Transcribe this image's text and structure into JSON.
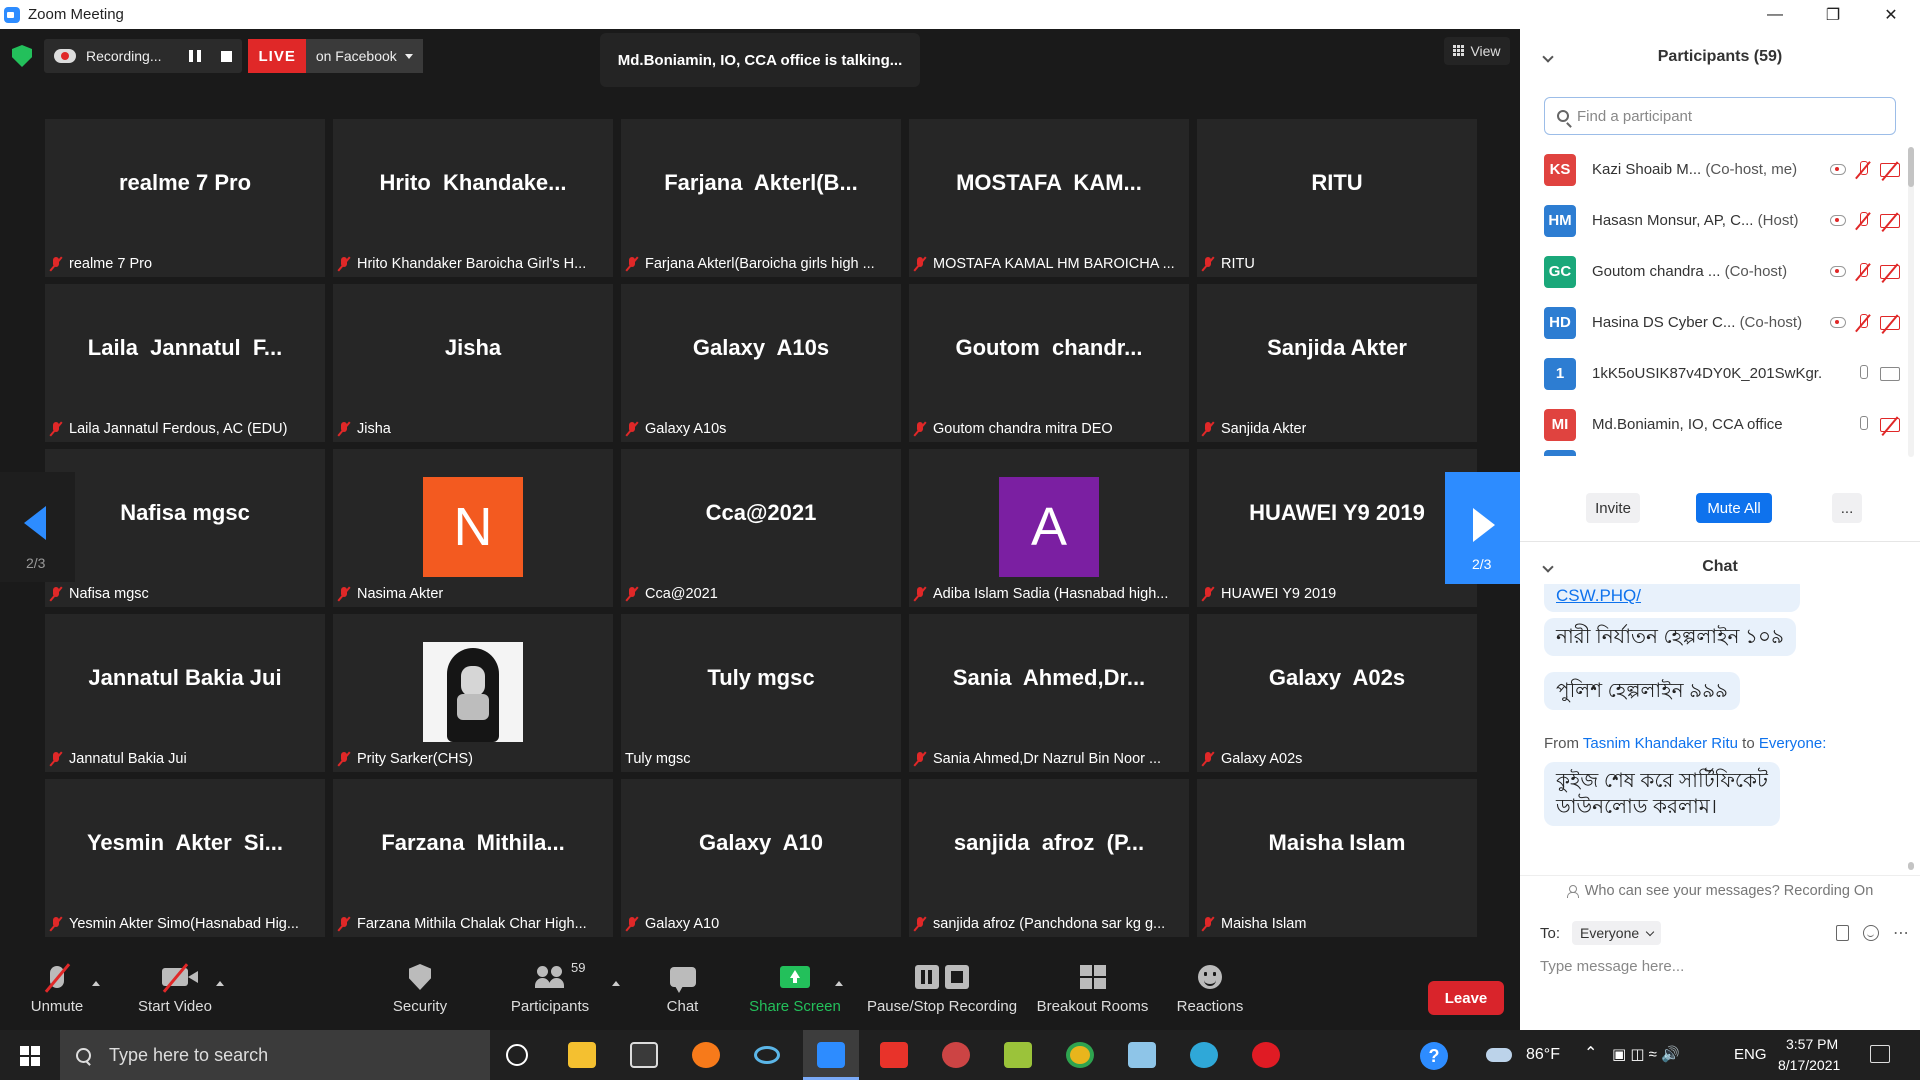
{
  "window": {
    "title": "Zoom Meeting"
  },
  "recording": {
    "status": "Recording...",
    "live_badge": "LIVE",
    "live_target": "on Facebook"
  },
  "talking": "Md.Boniamin, IO, CCA office is talking...",
  "view_label": "View",
  "tiles": [
    {
      "big": "realme 7 Pro",
      "label": "realme 7 Pro",
      "muted": true
    },
    {
      "big": "Hrito  Khandake...",
      "label": "Hrito Khandaker  Baroicha Girl's H...",
      "muted": true
    },
    {
      "big": "Farjana  Akterl(B...",
      "label": "Farjana Akterl(Baroicha girls high ...",
      "muted": true
    },
    {
      "big": "MOSTAFA  KAM...",
      "label": "MOSTAFA KAMAL HM BAROICHA ...",
      "muted": true
    },
    {
      "big": "RITU",
      "label": "RITU",
      "muted": true
    },
    {
      "big": "Laila  Jannatul  F...",
      "label": "Laila Jannatul Ferdous, AC (EDU)",
      "muted": true
    },
    {
      "big": "Jisha",
      "label": "Jisha",
      "muted": true
    },
    {
      "big": "Galaxy  A10s",
      "label": "Galaxy A10s",
      "muted": true
    },
    {
      "big": "Goutom  chandr...",
      "label": "Goutom chandra mitra DEO",
      "muted": true
    },
    {
      "big": "Sanjida Akter",
      "label": "Sanjida Akter",
      "muted": true
    },
    {
      "big": "Nafisa mgsc",
      "label": "Nafisa mgsc",
      "muted": true
    },
    {
      "big": "",
      "avatar": "N",
      "label": "Nasima Akter",
      "muted": true
    },
    {
      "big": "Cca@2021",
      "label": "Cca@2021",
      "muted": true
    },
    {
      "big": "",
      "avatar": "A",
      "label": "Adiba Islam Sadia (Hasnabad high...",
      "muted": true
    },
    {
      "big": "HUAWEI Y9 2019",
      "label": "HUAWEI Y9 2019",
      "muted": true
    },
    {
      "big": "Jannatul Bakia Jui",
      "label": "Jannatul Bakia Jui",
      "muted": true
    },
    {
      "big": "",
      "photo": true,
      "label": "Prity Sarker(CHS)",
      "muted": true
    },
    {
      "big": "Tuly mgsc",
      "label": "Tuly mgsc",
      "muted": false
    },
    {
      "big": "Sania  Ahmed,Dr...",
      "label": "Sania Ahmed,Dr Nazrul Bin Noor ...",
      "muted": true
    },
    {
      "big": "Galaxy  A02s",
      "label": "Galaxy A02s",
      "muted": true
    },
    {
      "big": "Yesmin  Akter  Si...",
      "label": "Yesmin Akter Simo(Hasnabad Hig...",
      "muted": true
    },
    {
      "big": "Farzana  Mithila...",
      "label": "Farzana Mithila   Chalak Char High...",
      "muted": true
    },
    {
      "big": "Galaxy  A10",
      "label": "Galaxy A10",
      "muted": true
    },
    {
      "big": "sanjida  afroz  (P...",
      "label": "sanjida afroz (Panchdona sar kg g...",
      "muted": true
    },
    {
      "big": "Maisha Islam",
      "label": "Maisha Islam",
      "muted": true
    }
  ],
  "pager": {
    "left": "2/3",
    "right": "2/3"
  },
  "toolbar": {
    "unmute": "Unmute",
    "start_video": "Start Video",
    "security": "Security",
    "participants": "Participants",
    "participants_count": "59",
    "chat": "Chat",
    "share_screen": "Share Screen",
    "pause_stop": "Pause/Stop Recording",
    "breakout": "Breakout Rooms",
    "reactions": "Reactions",
    "leave": "Leave"
  },
  "participants_panel": {
    "title": "Participants (59)",
    "search_placeholder": "Find a participant",
    "rows": [
      {
        "initials": "KS",
        "color": "#e0433f",
        "name": "Kazi Shoaib M...",
        "role": "(Co-host, me)",
        "rec": true,
        "mic": "off",
        "cam": "off"
      },
      {
        "initials": "HM",
        "color": "#2d7dd2",
        "name": "Hasasn Monsur, AP, C...",
        "role": "(Host)",
        "rec": true,
        "mic": "off",
        "cam": "off"
      },
      {
        "initials": "GC",
        "color": "#1aa87a",
        "name": "Goutom chandra ...",
        "role": "(Co-host)",
        "rec": true,
        "mic": "off",
        "cam": "off"
      },
      {
        "initials": "HD",
        "color": "#2d7dd2",
        "name": "Hasina DS Cyber C...",
        "role": "(Co-host)",
        "rec": true,
        "mic": "off",
        "cam": "off"
      },
      {
        "initials": "1",
        "color": "#2d7dd2",
        "name": "1kK5oUSIK87v4DY0K_201SwKgr...",
        "role": "",
        "rec": false,
        "mic": "on",
        "cam": "on"
      },
      {
        "initials": "MI",
        "color": "#e0433f",
        "name": "Md.Boniamin, IO, CCA office",
        "role": "",
        "rec": false,
        "mic": "on",
        "cam": "off"
      }
    ],
    "invite": "Invite",
    "mute_all": "Mute All",
    "more": "..."
  },
  "chat_panel": {
    "title": "Chat",
    "link": "CSW.PHQ/",
    "msg1": "নারী নির্যাতন হেল্পলাইন ১০৯",
    "msg2": "পুলিশ হেল্পলাইন ৯৯৯",
    "from_prefix": "From",
    "from_name": "Tasnim Khandaker Ritu",
    "from_to": "to",
    "from_target": "Everyone:",
    "msg3_line1": "কুইজ শেষ করে সার্টিফিকেট",
    "msg3_line2": "ডাউনলোড করলাম।",
    "who_can_see": "Who can see your messages? Recording On",
    "to_label": "To:",
    "to_value": "Everyone",
    "input_placeholder": "Type message here..."
  },
  "taskbar": {
    "search_text": "Type here to search",
    "temp": "86°F",
    "lang": "ENG",
    "time": "3:57 PM",
    "date": "8/17/2021"
  }
}
